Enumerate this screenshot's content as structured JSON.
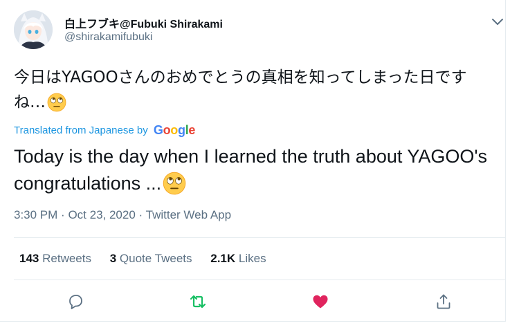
{
  "author": {
    "display_name": "白上フブキ@Fubuki Shirakami",
    "handle": "@shirakamifubuki"
  },
  "tweet": {
    "text": "今日はYAGOOさんのおめでとうの真相を知ってしまった日ですね…",
    "emoji": "face-with-rolling-eyes",
    "translated_from_label": "Translated from Japanese",
    "translated_by_label": "by",
    "translation_provider": "Google",
    "translation": "Today is the day when I learned the truth about YAGOO's congratulations ...",
    "time": "3:30 PM",
    "date": "Oct 23, 2020",
    "separator": "·",
    "source_app": "Twitter Web App"
  },
  "stats": {
    "retweets_count": "143",
    "retweets_label": "Retweets",
    "quote_count": "3",
    "quote_label": "Quote Tweets",
    "likes_count": "2.1K",
    "likes_label": "Likes"
  },
  "actions": [
    {
      "icon": "reply-icon"
    },
    {
      "icon": "retweet-icon"
    },
    {
      "icon": "like-icon"
    },
    {
      "icon": "share-icon"
    }
  ],
  "colors": {
    "text": "#0f1419",
    "secondary": "#5b7083",
    "link": "#1b95e0",
    "retweeted": "#17bf63",
    "liked": "#e0245e",
    "divider": "#e6ecf0"
  }
}
